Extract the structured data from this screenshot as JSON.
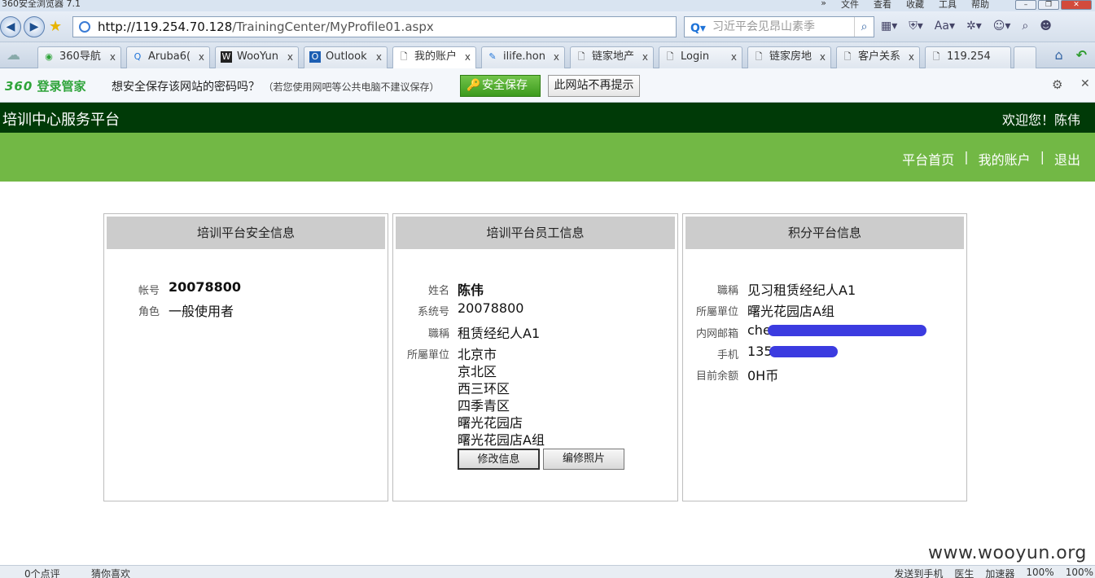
{
  "browser": {
    "window_title": "360安全浏览器 7.1",
    "menu": [
      "»",
      "文件",
      "查看",
      "收藏",
      "工具",
      "帮助"
    ],
    "url_host": "http://119.254.70.128",
    "url_path": "/TrainingCenter/MyProfile01.aspx",
    "search_placeholder": "习近平会见昂山素季",
    "tabs": [
      {
        "label": "360导航",
        "icon": "360-icon"
      },
      {
        "label": "Aruba6(",
        "icon": "search-q-icon"
      },
      {
        "label": "WooYun",
        "icon": "wooyun-icon"
      },
      {
        "label": "Outlook",
        "icon": "outlook-icon"
      },
      {
        "label": "我的账户",
        "icon": "page-icon"
      },
      {
        "label": "ilife.hon",
        "icon": "ilife-icon"
      },
      {
        "label": "链家地产",
        "icon": "page-icon"
      },
      {
        "label": "Login",
        "icon": "page-icon"
      },
      {
        "label": "链家房地",
        "icon": "page-icon"
      },
      {
        "label": "客户关系",
        "icon": "page-icon"
      },
      {
        "label": "119.254",
        "icon": "page-icon"
      }
    ],
    "tab_close": "x"
  },
  "password_bar": {
    "brand_num": "360",
    "brand_text": "登录管家",
    "question": "想安全保存该网站的密码吗？",
    "hint": "（若您使用网吧等公共电脑不建议保存）",
    "save_label": "安全保存",
    "no_label": "此网站不再提示"
  },
  "site": {
    "title": "培训中心服务平台",
    "welcome": "欢迎您！陈伟",
    "nav": [
      "平台首页",
      "我的账户",
      "退出"
    ],
    "nav_sep": "|"
  },
  "panels": {
    "security": {
      "heading": "培训平台安全信息",
      "account_label": "帐号",
      "account_value": "20078800",
      "role_label": "角色",
      "role_value": "一般使用者"
    },
    "employee": {
      "heading": "培训平台员工信息",
      "name_label": "姓名",
      "name_value": "陈伟",
      "sysno_label": "系统号",
      "sysno_value": "20078800",
      "title_label": "職稱",
      "title_value": "租赁经纪人A1",
      "unit_label": "所屬單位",
      "unit_lines": [
        "北京市",
        "京北区",
        "西三环区",
        "四季青区",
        "曙光花园店",
        "曙光花园店A组"
      ],
      "edit_info": "修改信息",
      "edit_photo": "编修照片"
    },
    "points": {
      "heading": "积分平台信息",
      "title_label": "職稱",
      "title_value": "见习租赁经纪人A1",
      "unit_label": "所屬單位",
      "unit_value": "曙光花园店A组",
      "email_label": "内网邮箱",
      "email_value": "che",
      "mobile_label": "手机",
      "mobile_value": "135",
      "balance_label": "目前余额",
      "balance_value": "0H币"
    }
  },
  "statusbar": {
    "comments": "0个点评",
    "guess": "猜你喜欢",
    "right": [
      "发送到手机",
      "医生",
      "加速器",
      "100%",
      "100%"
    ]
  },
  "watermark": "www.wooyun.org",
  "colors": {
    "header_dark_green": "#003a07",
    "nav_green": "#72b845",
    "panel_head_gray": "#cccccc",
    "redaction_blue": "#3b3be0"
  }
}
